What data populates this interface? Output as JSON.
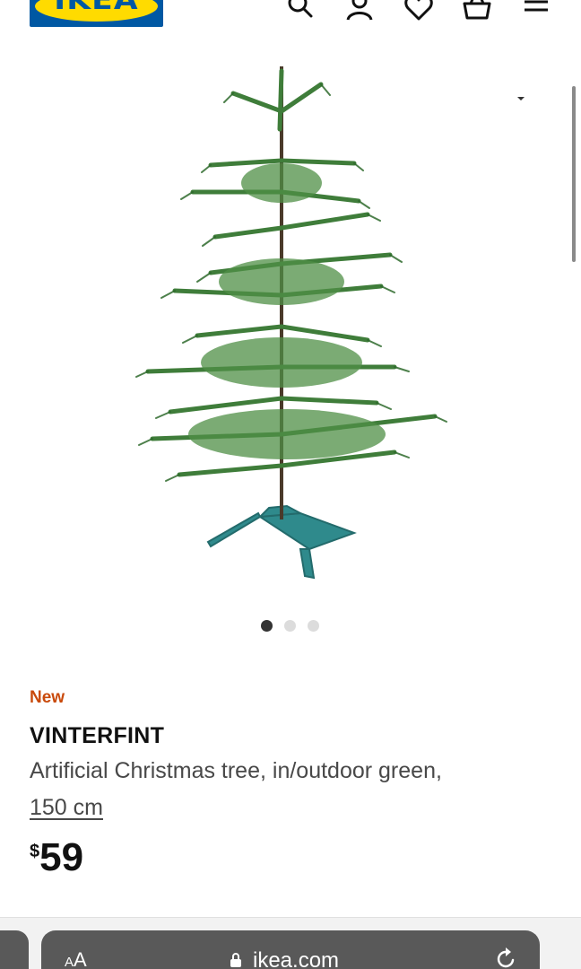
{
  "header": {
    "logo_text": "IKEA",
    "icons": [
      "search-icon",
      "account-icon",
      "heart-icon",
      "basket-icon",
      "menu-icon"
    ]
  },
  "gallery": {
    "image": "artificial-christmas-tree",
    "dot_count": 3,
    "active_dot": 1
  },
  "product": {
    "badge": "New",
    "name": "VINTERFINT",
    "description": "Artificial Christmas tree, in/outdoor green,",
    "size": "150 cm",
    "price_currency": "$",
    "price_value": "59"
  },
  "browser": {
    "aa_label_small": "A",
    "aa_label_large": "A",
    "url": "ikea.com",
    "icons": [
      "lock-icon",
      "reload-icon"
    ]
  },
  "colors": {
    "ikea_blue": "#0058a3",
    "ikea_yellow": "#ffdb00",
    "badge_orange": "#c94a0c",
    "tree_green": "#3f7d3a",
    "stand_teal": "#2f8a8c"
  }
}
